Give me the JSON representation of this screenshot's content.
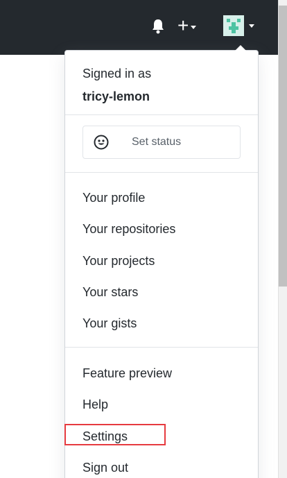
{
  "header": {
    "bell_icon": "bell-icon",
    "plus_icon": "plus-icon",
    "avatar_icon": "avatar-icon",
    "colors": {
      "bar": "#24292e",
      "avatar_bg": "#d8f0ea",
      "avatar_fg": "#4ec3a3"
    }
  },
  "user_menu": {
    "signed_in_label": "Signed in as",
    "username": "tricy-lemon",
    "set_status": {
      "label": "Set status",
      "icon": "smiley-icon"
    },
    "items": [
      {
        "label": "Your profile"
      },
      {
        "label": "Your repositories"
      },
      {
        "label": "Your projects"
      },
      {
        "label": "Your stars"
      },
      {
        "label": "Your gists"
      }
    ],
    "footer_items": [
      {
        "label": "Feature preview"
      },
      {
        "label": "Help"
      },
      {
        "label": "Settings",
        "highlighted": true
      },
      {
        "label": "Sign out"
      }
    ],
    "colors": {
      "highlight": "#e63a3f"
    }
  }
}
